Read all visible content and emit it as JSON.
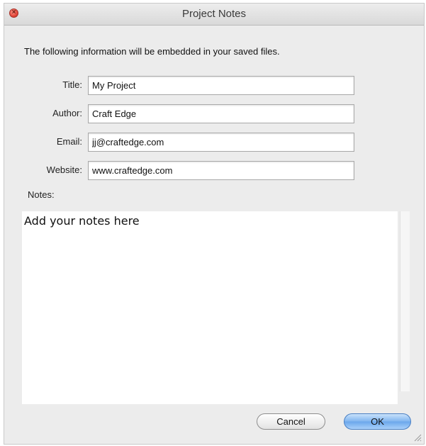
{
  "window": {
    "title": "Project Notes"
  },
  "intro_text": "The following information will be embedded in your saved files.",
  "fields": {
    "title": {
      "label": "Title:",
      "value": "My Project"
    },
    "author": {
      "label": "Author:",
      "value": "Craft Edge"
    },
    "email": {
      "label": "Email:",
      "value": "jj@craftedge.com"
    },
    "website": {
      "label": "Website:",
      "value": "www.craftedge.com"
    }
  },
  "notes": {
    "label": "Notes:",
    "value": "Add your notes here"
  },
  "buttons": {
    "cancel": "Cancel",
    "ok": "OK"
  },
  "icons": {
    "close": "close-icon",
    "resize": "resize-grip-icon"
  },
  "colors": {
    "close_red": "#e2463a",
    "default_button_blue": "#7fb4ef"
  }
}
